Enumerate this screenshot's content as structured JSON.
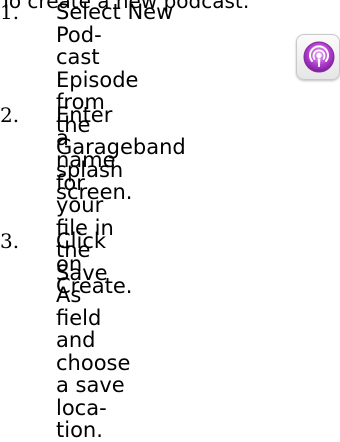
{
  "intro_text": "To create a new podcast:",
  "steps": [
    {
      "number": "1.",
      "text": "Select New Pod-\ncast Episode from\nthe Garageband\nsplash screen."
    },
    {
      "number": "2.",
      "text": "Enter a name for your\nfile in the Save As field\nand choose a save loca-\ntion."
    },
    {
      "number": "3.",
      "text": "Click on Create."
    }
  ],
  "icon": {
    "name": "podcast-icon",
    "accent_color": "#a93bc4"
  }
}
